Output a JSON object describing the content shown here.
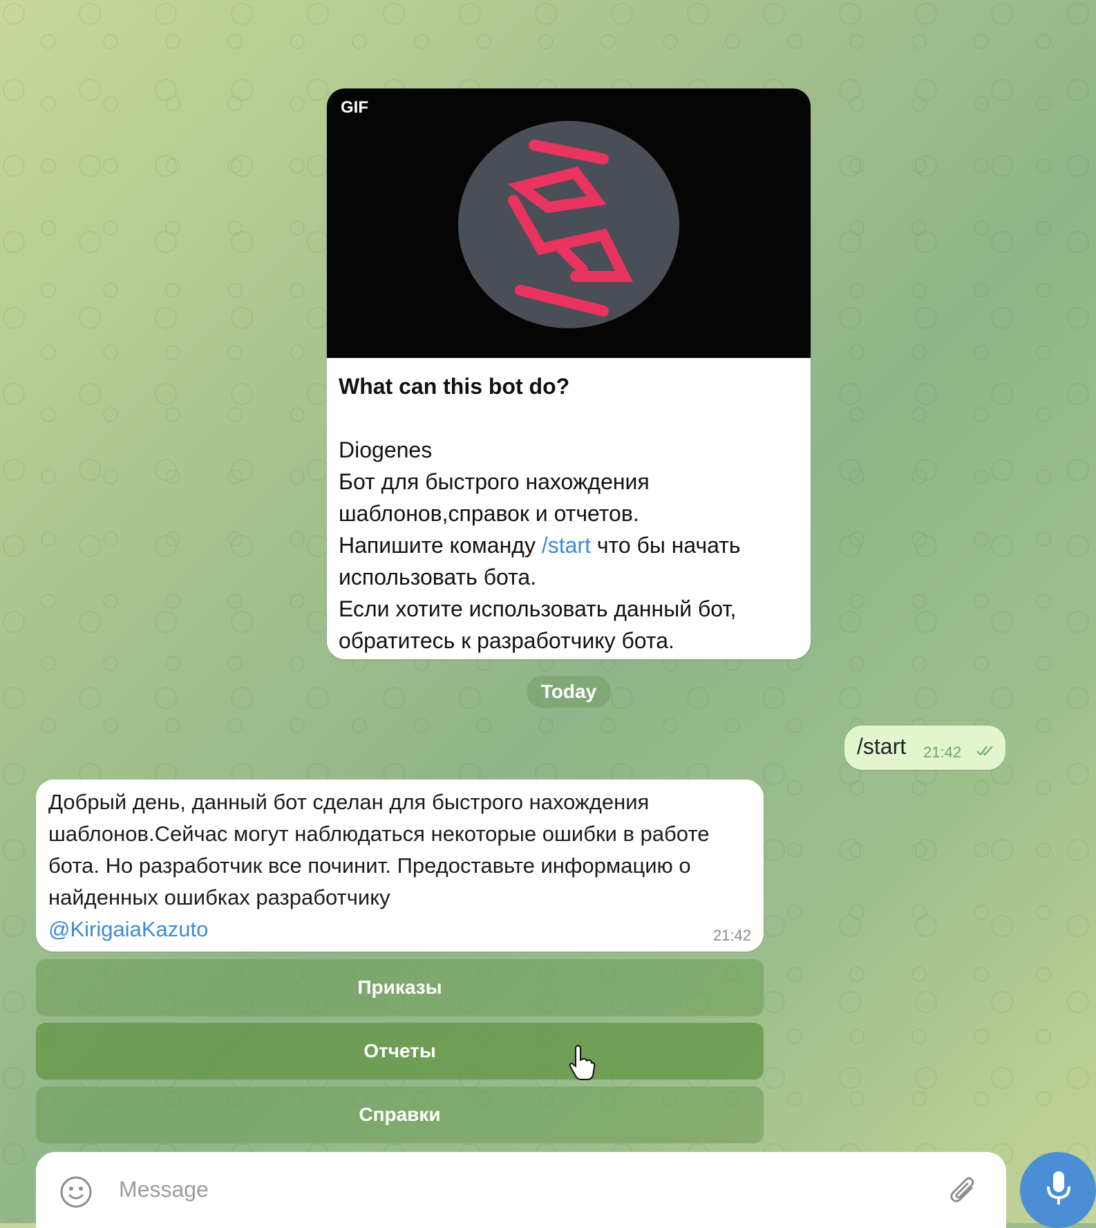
{
  "gif_card": {
    "badge": "GIF",
    "title": "What can this bot do?",
    "lines": [
      "Diogenes",
      "Бот для быстрого нахождения",
      "шаблонов,справок и отчетов."
    ],
    "cmd_prefix": "Напишите команду ",
    "cmd_link": "/start",
    "cmd_suffix": " что бы начать",
    "lines2": [
      "использовать бота.",
      "Если хотите использовать данный бот,",
      "обратитесь к разработчику бота."
    ]
  },
  "date_separator": "Today",
  "outgoing": {
    "text": "/start",
    "time": "21:42"
  },
  "welcome": {
    "text": "Добрый день, данный бот сделан для быстрого нахождения шаблонов.Сейчас могут наблюдаться некоторые ошибки в работе бота. Но разработчик все починит. Предоставьте информацию о найденных ошибках разработчику",
    "mention": "@KirigaiaKazuto",
    "time": "21:42"
  },
  "keyboard": {
    "buttons": [
      "Приказы",
      "Отчеты",
      "Справки"
    ]
  },
  "composer": {
    "placeholder": "Message"
  },
  "colors": {
    "accent": "#4a8fd6",
    "link": "#3a8bd6",
    "outgoing_bubble": "#e3f5cf",
    "gif_logo": "#e8345e"
  }
}
